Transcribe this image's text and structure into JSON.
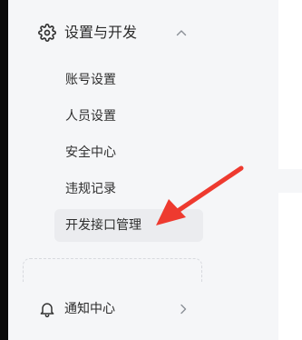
{
  "sidebar": {
    "group": {
      "title": "设置与开发",
      "icon": "gear-icon",
      "chevron": "chevron-up-icon",
      "items": [
        {
          "label": "账号设置",
          "active": false
        },
        {
          "label": "人员设置",
          "active": false
        },
        {
          "label": "安全中心",
          "active": false
        },
        {
          "label": "违规记录",
          "active": false
        },
        {
          "label": "开发接口管理",
          "active": true
        }
      ]
    },
    "partial_box_text": "",
    "notify": {
      "label": "通知中心",
      "icon": "bell-icon",
      "chevron": "chevron-right-icon"
    }
  },
  "annotation": {
    "type": "arrow",
    "color": "#ee3a2f",
    "points_to": "开发接口管理"
  },
  "colors": {
    "sidebar_bg": "#f5f6f8",
    "active_item_bg": "#ebecef",
    "text": "#2f2f2f",
    "arrow": "#ee3a2f"
  }
}
